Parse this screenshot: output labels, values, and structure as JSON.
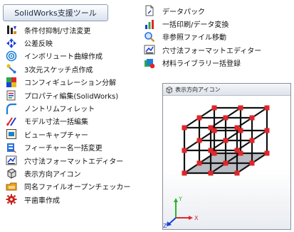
{
  "toolbar": {
    "button_label": "SolidWorks支援ツール"
  },
  "menu_left": [
    {
      "label": "条件付抑制/寸法変更",
      "icon": "dimension-suppress-icon"
    },
    {
      "label": "公差反映",
      "icon": "tolerance-arrows-icon"
    },
    {
      "label": "インボリュート曲線作成",
      "icon": "involute-curve-icon"
    },
    {
      "label": "3次元スケッチ点作成",
      "icon": "sketch-point-icon"
    },
    {
      "label": "コンフィギュレーション分解",
      "icon": "configuration-split-icon"
    },
    {
      "label": "プロパティ編集(SolidWorks)",
      "icon": "property-edit-icon"
    },
    {
      "label": "ノントリムフィレット",
      "icon": "fillet-icon"
    },
    {
      "label": "モデル寸法一括編集",
      "icon": "model-dimension-icon"
    },
    {
      "label": "ビューキャプチャー",
      "icon": "view-capture-icon"
    },
    {
      "label": "フィーチャー名一括変更",
      "icon": "feature-rename-icon"
    },
    {
      "label": "穴寸法フォーマットエディター",
      "icon": "hole-format-icon"
    },
    {
      "label": "表示方向アイコン",
      "icon": "view-orientation-icon"
    },
    {
      "label": "同名ファイルオープンチェッカー",
      "icon": "file-checker-icon"
    },
    {
      "label": "平歯車作成",
      "icon": "gear-icon"
    }
  ],
  "menu_right": [
    {
      "label": "データパック",
      "icon": "data-pack-icon"
    },
    {
      "label": "一括印刷/データ変換",
      "icon": "batch-print-icon"
    },
    {
      "label": "非参照ファイル移動",
      "icon": "file-move-icon"
    },
    {
      "label": "穴寸法フォーマットエディター",
      "icon": "hole-format-icon"
    },
    {
      "label": "材料ライブラリー括登録",
      "icon": "material-library-icon"
    }
  ],
  "subwindow": {
    "title": "表示方向アイコン",
    "title_icon": "view-orientation-icon",
    "axes": {
      "x_label": "X",
      "y_label": "Y",
      "z_label": "Z"
    }
  },
  "colors": {
    "vertex": "#e0262b",
    "frame": "#111111",
    "floor": "#b9bcc2",
    "axis_x": "#e0262b",
    "axis_y": "#2ab42a",
    "axis_z": "#1b3fd6"
  }
}
